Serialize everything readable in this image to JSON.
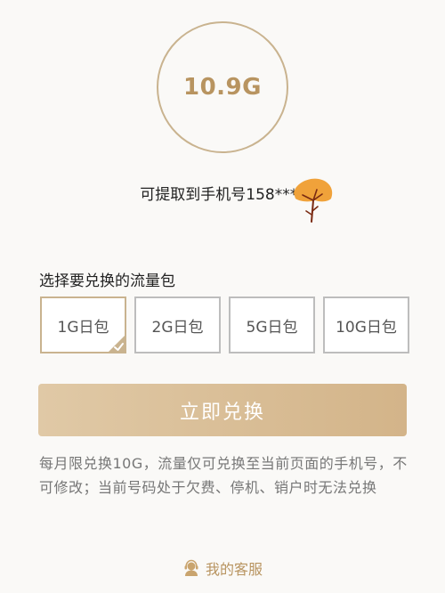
{
  "balance": {
    "amount": "10.9G"
  },
  "phone": {
    "text": "可提取到手机号158****"
  },
  "package": {
    "label": "选择要兑换的流量包",
    "options": [
      "1G日包",
      "2G日包",
      "5G日包",
      "10G日包"
    ],
    "selected_index": 0
  },
  "exchange_button": {
    "label": "立即兑换"
  },
  "notice": "每月限兑换10G，流量仅可兑换至当前页面的手机号，不可修改；当前号码处于欠费、停机、销户时无法兑换",
  "service": {
    "label": "我的客服",
    "icon": "customer-service-icon"
  },
  "colors": {
    "accent": "#b89460",
    "button": "#d8bd95",
    "border_selected": "#c9b38f"
  }
}
